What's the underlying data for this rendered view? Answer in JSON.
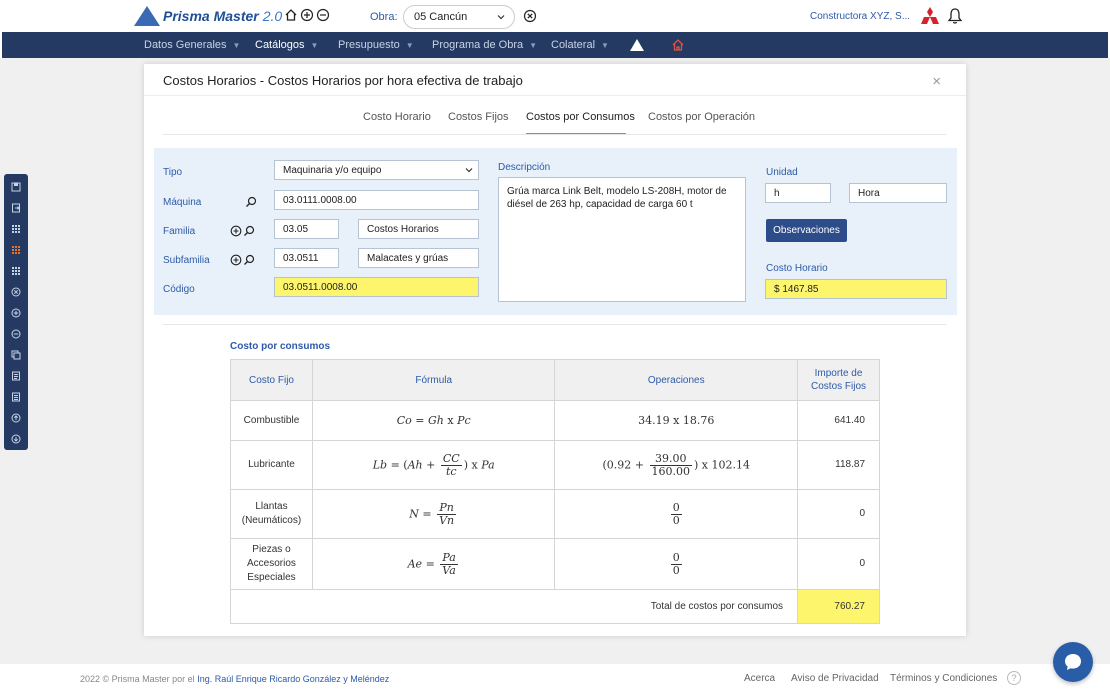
{
  "header": {
    "app_name": "Prisma Master",
    "app_version": "2.0",
    "obra_label": "Obra:",
    "obra_value": "05 Cancún",
    "company": "Constructora XYZ, S..."
  },
  "nav": {
    "items": [
      {
        "label": "Datos Generales"
      },
      {
        "label": "Catálogos"
      },
      {
        "label": "Presupuesto"
      },
      {
        "label": "Programa de Obra"
      },
      {
        "label": "Colateral"
      }
    ]
  },
  "modal": {
    "title": "Costos Horarios - Costos Horarios por hora efectiva de trabajo",
    "close": "×",
    "tabs": [
      "Costo Horario",
      "Costos Fijos",
      "Costos por Consumos",
      "Costos por Operación"
    ],
    "active_tab": "Costos por Consumos"
  },
  "form": {
    "tipo_label": "Tipo",
    "tipo_value": "Maquinaria y/o equipo",
    "maquina_label": "Máquina",
    "maquina_value": "03.0111.0008.00",
    "familia_label": "Familia",
    "familia_code": "03.05",
    "familia_name": "Costos Horarios",
    "subfamilia_label": "Subfamilia",
    "subfamilia_code": "03.0511",
    "subfamilia_name": "Malacates y grúas",
    "codigo_label": "Código",
    "codigo_value": "03.0511.0008.00",
    "descripcion_label": "Descripción",
    "descripcion_value": "Grúa marca Link Belt, modelo LS-208H, motor de diésel de 263 hp, capacidad de carga 60 t",
    "unidad_label": "Unidad",
    "unidad_code": "h",
    "unidad_name": "Hora",
    "observaciones_button": "Observaciones",
    "costo_horario_label": "Costo Horario",
    "costo_horario_value": "$ 1467.85"
  },
  "consumos": {
    "title": "Costo por consumos",
    "headers": {
      "costo_fijo": "Costo Fijo",
      "formula": "Fórmula",
      "operaciones": "Operaciones",
      "importe_1": "Importe de",
      "importe_2": "Costos Fijos"
    },
    "rows": [
      {
        "name": "Combustible",
        "value": "641.40",
        "ops": "34.19 x 18.76"
      },
      {
        "name": "Lubricante",
        "value": "118.87",
        "ops_a": "(0.92 +",
        "ops_num": "39.00",
        "ops_den": "160.00",
        "ops_b": ") x 102.14"
      },
      {
        "name_1": "Llantas",
        "name_2": "(Neumáticos)",
        "value": "0",
        "ops_num": "0",
        "ops_den": "0"
      },
      {
        "name_1": "Piezas o",
        "name_2": "Accesorios",
        "name_3": "Especiales",
        "value": "0",
        "ops_num": "0",
        "ops_den": "0"
      }
    ],
    "formulas": {
      "combustible": {
        "lhs": "Co",
        "a": "Gh",
        "b": "Pc"
      },
      "lubricante": {
        "lhs": "Lb",
        "a": "Ah",
        "num": "CC",
        "den": "tc",
        "b": "Pa"
      },
      "llantas": {
        "lhs": "N",
        "num": "Pn",
        "den": "Vn"
      },
      "piezas": {
        "lhs": "Ae",
        "num": "Pa",
        "den": "Va"
      }
    },
    "total_label": "Total de costos por consumos",
    "total_value": "760.27"
  },
  "footer": {
    "prefix": "2022 © Prisma Master por el ",
    "author": "Ing. Raúl Enrique Ricardo González y Meléndez",
    "links": [
      "Acerca",
      "Aviso de Privacidad",
      "Términos y Condiciones"
    ],
    "help": "?"
  }
}
